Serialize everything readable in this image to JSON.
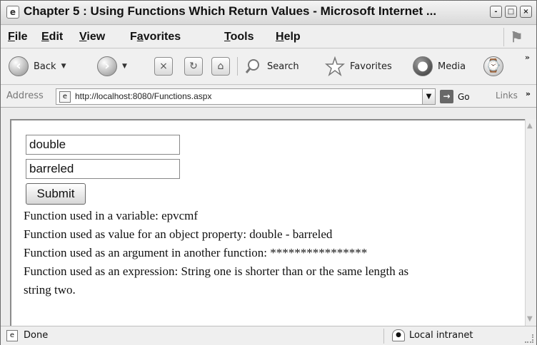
{
  "window": {
    "title": "Chapter 5 : Using Functions Which Return Values - Microsoft Internet ...",
    "controls": [
      "-",
      "□",
      "×"
    ]
  },
  "menu": {
    "items": [
      {
        "prefix": "",
        "accel": "F",
        "suffix": "ile"
      },
      {
        "prefix": "",
        "accel": "E",
        "suffix": "dit"
      },
      {
        "prefix": "",
        "accel": "V",
        "suffix": "iew"
      },
      {
        "prefix": "F",
        "accel": "a",
        "suffix": "vorites"
      },
      {
        "prefix": "",
        "accel": "T",
        "suffix": "ools"
      },
      {
        "prefix": "",
        "accel": "H",
        "suffix": "elp"
      }
    ]
  },
  "toolbar": {
    "back_label": "Back",
    "search_label": "Search",
    "favorites_label": "Favorites",
    "media_label": "Media",
    "overflow_label": "»"
  },
  "address_bar": {
    "label": "Address",
    "url": "http://localhost:8080/Functions.aspx",
    "go_label": "Go",
    "links_label": "Links",
    "overflow_label": "»"
  },
  "form": {
    "first_field_value": "double",
    "second_field_value": "barreled",
    "submit_label": "Submit"
  },
  "results": [
    "Function used in a variable: epvcmf",
    "Function used as value for an object property: double - barreled",
    "Function used as an argument in another function: ****************",
    "Function used as an expression: String one is shorter than or the same length as",
    "string two."
  ],
  "status": {
    "text": "Done",
    "zone": "Local intranet"
  },
  "icons": {
    "title": "ie-page-icon",
    "back": "back-arrow-icon",
    "forward": "forward-arrow-icon",
    "stop": "stop-icon",
    "refresh": "refresh-icon",
    "home": "home-icon",
    "search": "search-icon",
    "favorites": "favorites-star-icon",
    "media": "media-icon",
    "history": "history-icon",
    "go": "go-arrow-icon",
    "status": "page-icon",
    "zone": "local-intranet-icon"
  },
  "colors": {
    "frame": "#ececec",
    "content": "#ffffff",
    "text": "#111111"
  }
}
